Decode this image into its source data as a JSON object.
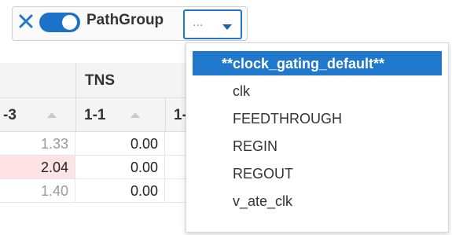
{
  "filter": {
    "label": "PathGroup",
    "select_value": "...",
    "toggle_on": true,
    "colors": {
      "accent": "#1f78cc",
      "close": "#1f78cc"
    }
  },
  "table": {
    "group_header": "TNS",
    "columns": [
      "-3",
      "1-1",
      "1-"
    ],
    "rows": [
      {
        "c1": "1.33",
        "c2": "0.00",
        "highlight": false
      },
      {
        "c1": "2.04",
        "c2": "0.00",
        "highlight": true
      },
      {
        "c1": "1.40",
        "c2": "0.00",
        "highlight": false
      }
    ],
    "highlight_color": "#fde3e3"
  },
  "dropdown": {
    "options": [
      {
        "label": "**clock_gating_default**",
        "selected": true
      },
      {
        "label": "clk",
        "selected": false
      },
      {
        "label": "FEEDTHROUGH",
        "selected": false
      },
      {
        "label": "REGIN",
        "selected": false
      },
      {
        "label": "REGOUT",
        "selected": false
      },
      {
        "label": "v_ate_clk",
        "selected": false
      }
    ]
  }
}
